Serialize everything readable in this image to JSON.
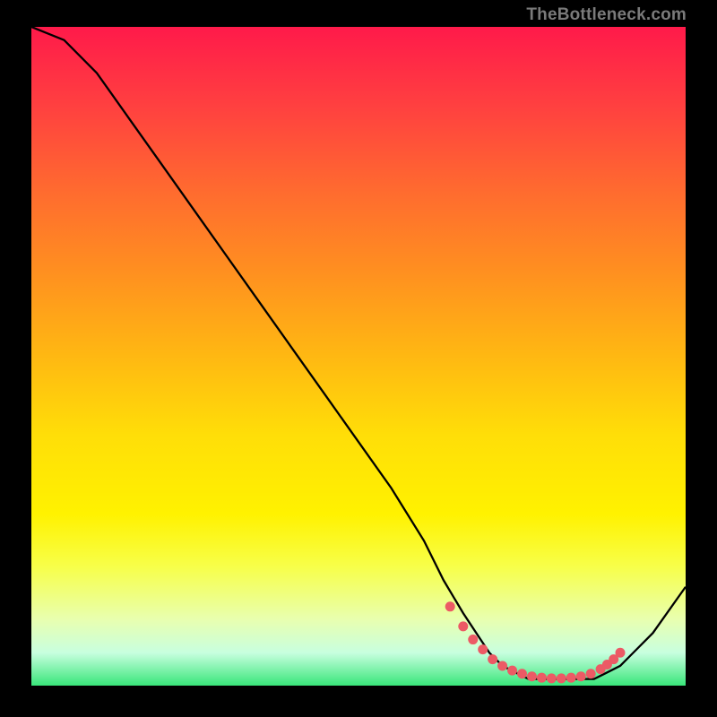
{
  "attribution": "TheBottleneck.com",
  "chart_data": {
    "type": "line",
    "title": "",
    "xlabel": "",
    "ylabel": "",
    "xlim": [
      0,
      100
    ],
    "ylim": [
      0,
      100
    ],
    "series": [
      {
        "name": "curve",
        "x": [
          0,
          5,
          10,
          15,
          20,
          25,
          30,
          35,
          40,
          45,
          50,
          55,
          60,
          63,
          66,
          68,
          70,
          72,
          74,
          76,
          78,
          80,
          82,
          84,
          86,
          88,
          90,
          92,
          95,
          100
        ],
        "y": [
          100,
          98,
          93,
          86,
          79,
          72,
          65,
          58,
          51,
          44,
          37,
          30,
          22,
          16,
          11,
          8,
          5,
          3,
          2,
          1,
          1,
          1,
          1,
          1,
          1,
          2,
          3,
          5,
          8,
          15
        ]
      }
    ],
    "markers": {
      "name": "bottom-dots",
      "x": [
        64,
        66,
        67.5,
        69,
        70.5,
        72,
        73.5,
        75,
        76.5,
        78,
        79.5,
        81,
        82.5,
        84,
        85.5,
        87,
        88,
        89,
        90
      ],
      "y": [
        12,
        9,
        7,
        5.5,
        4,
        3,
        2.3,
        1.8,
        1.4,
        1.2,
        1.1,
        1.1,
        1.2,
        1.4,
        1.8,
        2.5,
        3.2,
        4,
        5
      ]
    },
    "gradient_stops": [
      {
        "pos": 0,
        "color": "#ff1a4a"
      },
      {
        "pos": 12,
        "color": "#ff4040"
      },
      {
        "pos": 25,
        "color": "#ff6b2f"
      },
      {
        "pos": 37,
        "color": "#ff8f20"
      },
      {
        "pos": 50,
        "color": "#ffb812"
      },
      {
        "pos": 62,
        "color": "#ffde08"
      },
      {
        "pos": 74,
        "color": "#fff200"
      },
      {
        "pos": 82,
        "color": "#f7ff4a"
      },
      {
        "pos": 90,
        "color": "#e8ffb0"
      },
      {
        "pos": 95,
        "color": "#c8ffdf"
      },
      {
        "pos": 100,
        "color": "#39e67a"
      }
    ],
    "marker_color": "#ec5a65",
    "curve_color": "#000000"
  }
}
